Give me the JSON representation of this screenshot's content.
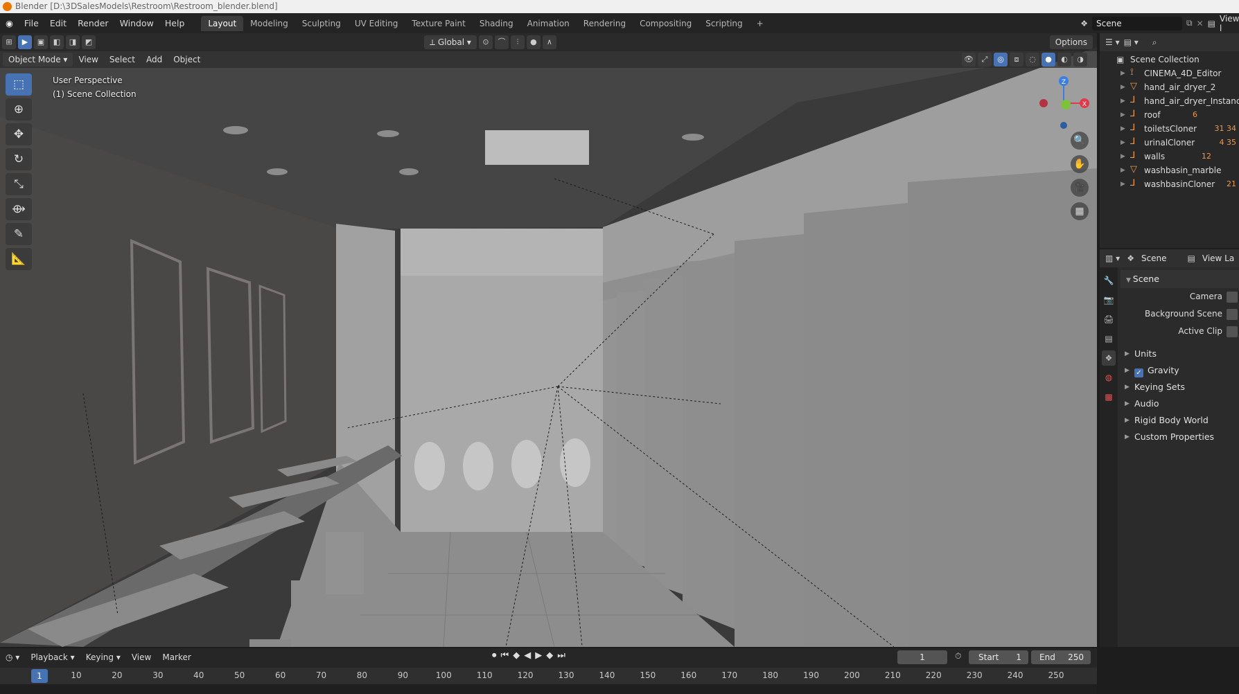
{
  "window": {
    "title": "Blender [D:\\3DSalesModels\\Restroom\\Restroom_blender.blend]"
  },
  "menu": [
    "File",
    "Edit",
    "Render",
    "Window",
    "Help"
  ],
  "workspaces": [
    "Layout",
    "Modeling",
    "Sculpting",
    "UV Editing",
    "Texture Paint",
    "Shading",
    "Animation",
    "Rendering",
    "Compositing",
    "Scripting"
  ],
  "active_workspace": "Layout",
  "topbar": {
    "scene": "Scene",
    "view_layer": "View l"
  },
  "viewport": {
    "mode": "Object Mode",
    "menus": [
      "View",
      "Select",
      "Add",
      "Object"
    ],
    "orientation": "Global",
    "options_label": "Options",
    "info_line1": "User Perspective",
    "info_line2": "(1) Scene Collection"
  },
  "gizmo": {
    "x": "X",
    "z": "Z"
  },
  "outliner": {
    "root": "Scene Collection",
    "items": [
      {
        "name": "CINEMA_4D_Editor"
      },
      {
        "name": "hand_air_dryer_2"
      },
      {
        "name": "hand_air_dryer_Instance"
      },
      {
        "name": "roof",
        "extra": "6"
      },
      {
        "name": "toiletsCloner",
        "extra": "31  34"
      },
      {
        "name": "urinalCloner",
        "extra": "4  35"
      },
      {
        "name": "walls",
        "extra": "12"
      },
      {
        "name": "washbasin_marble"
      },
      {
        "name": "washbasinCloner",
        "extra": "21"
      }
    ]
  },
  "properties": {
    "header_scene": "Scene",
    "header_viewlayer": "View La",
    "panel": "Scene",
    "rows": [
      {
        "label": "Camera"
      },
      {
        "label": "Background Scene"
      },
      {
        "label": "Active Clip"
      }
    ],
    "subpanels": [
      "Units",
      "Gravity",
      "Keying Sets",
      "Audio",
      "Rigid Body World",
      "Custom Properties"
    ]
  },
  "timeline": {
    "menus": [
      "Playback",
      "Keying",
      "View",
      "Marker"
    ],
    "current_frame": "1",
    "start_label": "Start",
    "start": "1",
    "end_label": "End",
    "end": "250",
    "ruler": [
      "1",
      "10",
      "20",
      "30",
      "40",
      "50",
      "60",
      "70",
      "80",
      "90",
      "100",
      "110",
      "120",
      "130",
      "140",
      "150",
      "160",
      "170",
      "180",
      "190",
      "200",
      "210",
      "220",
      "230",
      "240",
      "250"
    ]
  },
  "colors": {
    "accent": "#4772b3",
    "object_orange": "#ee9848",
    "axis_x": "#e23a4a",
    "axis_y": "#7ec13a",
    "axis_z": "#3a7ee2"
  }
}
